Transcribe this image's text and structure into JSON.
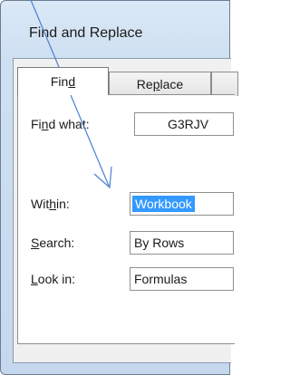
{
  "dialog": {
    "title": "Find and Replace"
  },
  "tabs": [
    {
      "label_pre": "Fin",
      "label_key": "d",
      "label_post": ""
    },
    {
      "label_pre": "Re",
      "label_key": "p",
      "label_post": "lace"
    }
  ],
  "fields": {
    "find_what": {
      "label_pre": "Fi",
      "label_key": "n",
      "label_post": "d what:",
      "value": "G3RJV"
    },
    "within": {
      "label_pre": "Wit",
      "label_key": "h",
      "label_post": "in:",
      "value": "Workbook"
    },
    "search": {
      "label_pre": "",
      "label_key": "S",
      "label_post": "earch:",
      "value": "By Rows"
    },
    "look_in": {
      "label_pre": "",
      "label_key": "L",
      "label_post": "ook in:",
      "value": "Formulas"
    }
  },
  "annotation": {
    "color": "#4a7fd6",
    "description": "arrow"
  }
}
